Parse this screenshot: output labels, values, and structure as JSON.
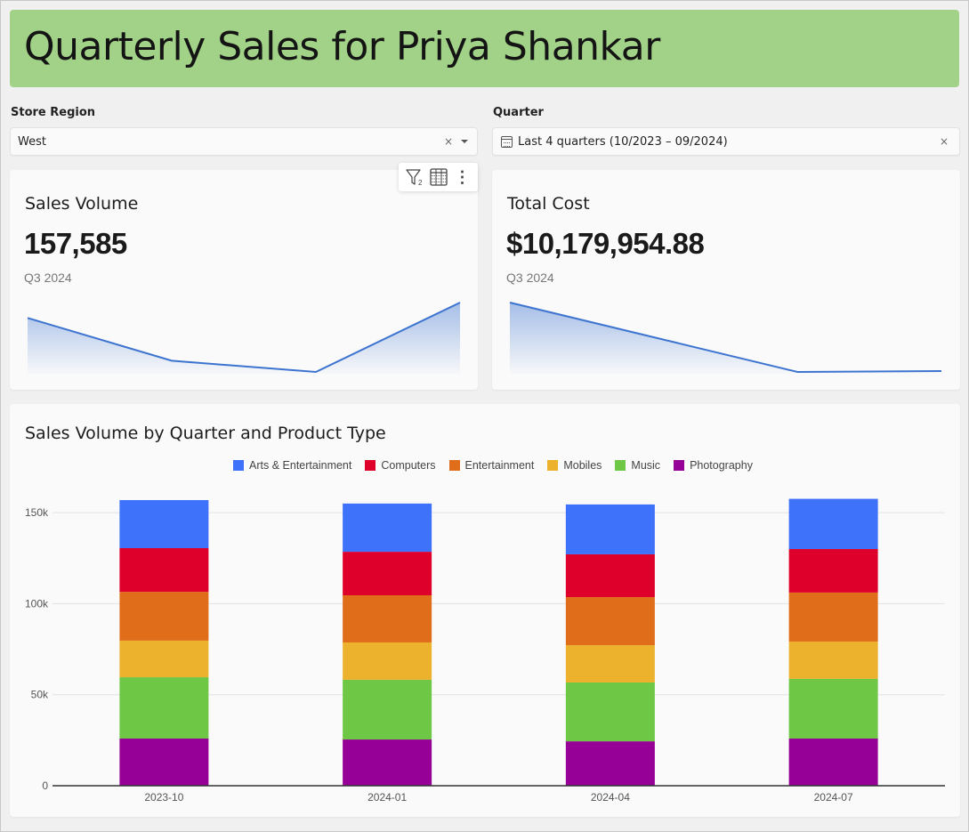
{
  "header": {
    "title": "Quarterly Sales for Priya Shankar",
    "banner_color": "#a2d287"
  },
  "controls": {
    "store_region": {
      "label": "Store Region",
      "value": "West"
    },
    "quarter": {
      "label": "Quarter",
      "value": "Last 4 quarters (10/2023 – 09/2024)"
    }
  },
  "icons": {
    "clear": "×",
    "filter_count": "2",
    "more": "⋮"
  },
  "kpis": [
    {
      "title": "Sales Volume",
      "value": "157,585",
      "period": "Q3 2024",
      "trend": [
        156900,
        155000,
        154500,
        157585
      ]
    },
    {
      "title": "Total Cost",
      "value": "$10,179,954.88",
      "period": "Q3 2024",
      "trend": [
        10950000,
        10560000,
        10170000,
        10179954.88
      ]
    }
  ],
  "chart_data": {
    "type": "bar",
    "stacked": true,
    "title": "Sales Volume by Quarter and Product Type",
    "xlabel": "",
    "ylabel": "",
    "categories": [
      "2023-10",
      "2024-01",
      "2024-04",
      "2024-07"
    ],
    "ylim": [
      0,
      160000
    ],
    "yticks": [
      0,
      50000,
      100000,
      150000
    ],
    "ytick_labels": [
      "0",
      "50k",
      "100k",
      "150k"
    ],
    "grid": true,
    "legend_position": "top-center",
    "series": [
      {
        "name": "Photography",
        "color": "#960096",
        "values": [
          25900,
          25400,
          24400,
          25900
        ]
      },
      {
        "name": "Music",
        "color": "#6fc746",
        "values": [
          33700,
          32800,
          32300,
          32800
        ]
      },
      {
        "name": "Mobiles",
        "color": "#ecb22e",
        "values": [
          20100,
          20500,
          20500,
          20500
        ]
      },
      {
        "name": "Entertainment",
        "color": "#e06d1a",
        "values": [
          26800,
          25900,
          26400,
          26900
        ]
      },
      {
        "name": "Computers",
        "color": "#de002b",
        "values": [
          24000,
          23900,
          23500,
          23900
        ]
      },
      {
        "name": "Arts & Entertainment",
        "color": "#3f72fb",
        "values": [
          26400,
          26500,
          27400,
          27585
        ]
      }
    ],
    "legend_order": [
      "Arts & Entertainment",
      "Computers",
      "Entertainment",
      "Mobiles",
      "Music",
      "Photography"
    ]
  }
}
